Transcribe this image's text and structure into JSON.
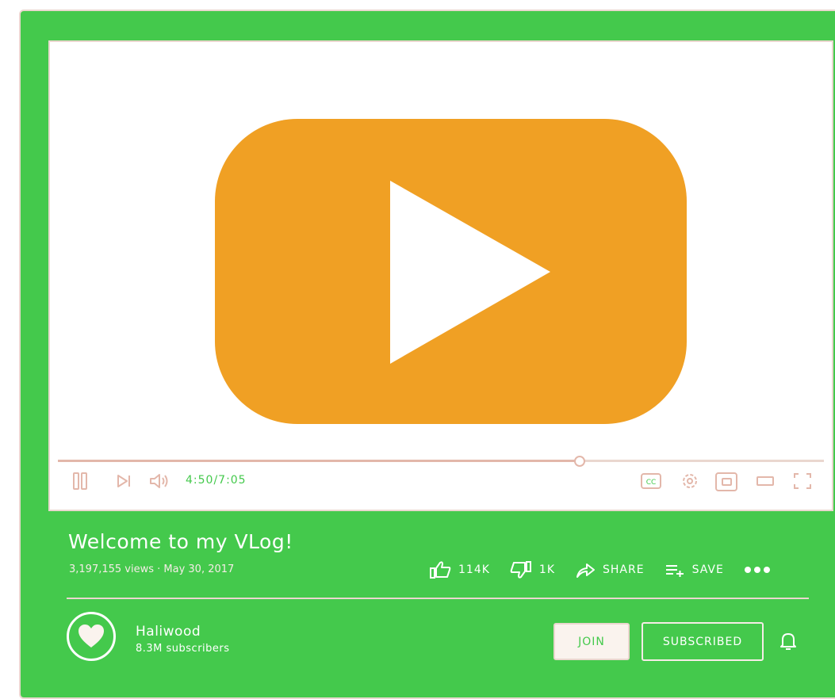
{
  "player": {
    "progress_fraction": 0.68,
    "time_display": "4:50/7:05"
  },
  "video": {
    "title": "Welcome to my VLog!",
    "meta": "3,197,155 views · May 30, 2017",
    "likes": "114K",
    "dislikes": "1K",
    "share_label": "SHARE",
    "save_label": "SAVE"
  },
  "channel": {
    "name": "Haliwood",
    "subscribers": "8.3M subscribers",
    "join_label": "JOIN",
    "subscribed_label": "SUBSCRIBED"
  },
  "colors": {
    "background": "#44c94c",
    "accent_orange": "#f0a024",
    "outline_pink": "#ead7cf",
    "white": "#ffffff"
  },
  "icons": [
    "play-icon",
    "pause-icon",
    "next-icon",
    "volume-icon",
    "captions-icon",
    "settings-icon",
    "miniplayer-icon",
    "theater-icon",
    "fullscreen-icon",
    "thumbs-up-icon",
    "thumbs-down-icon",
    "share-icon",
    "save-icon",
    "more-icon",
    "heart-icon",
    "bell-icon"
  ]
}
